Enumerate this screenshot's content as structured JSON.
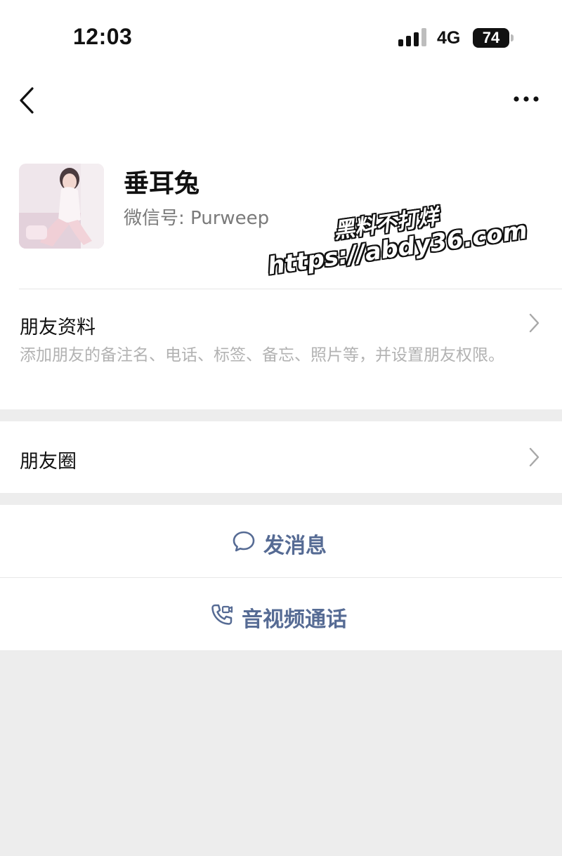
{
  "status_bar": {
    "time": "12:03",
    "network": "4G",
    "battery": "74"
  },
  "profile": {
    "name": "垂耳兔",
    "wechat_id": "微信号: Purweep"
  },
  "friend_info": {
    "title": "朋友资料",
    "description": "添加朋友的备注名、电话、标签、备忘、照片等，并设置朋友权限。"
  },
  "moments": {
    "title": "朋友圈"
  },
  "actions": {
    "message": "发消息",
    "call": "音视频通话"
  },
  "watermark": {
    "line1": "黑料不打烊",
    "line2": "https://abdy36.com"
  },
  "colors": {
    "accent": "#566b94",
    "background": "#ededed",
    "secondary_text": "#b2b2b2"
  }
}
